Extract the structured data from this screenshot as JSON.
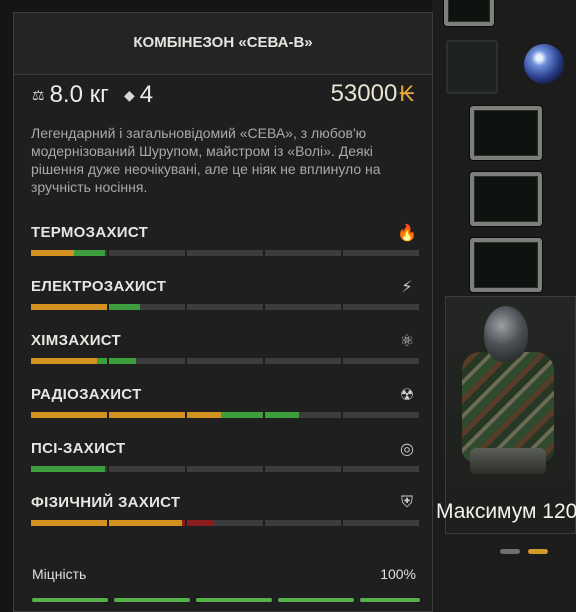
{
  "panel": {
    "title": "КОМБІНЕЗОН «СЕВА-В»",
    "weight": "8.0 кг",
    "slots": "4",
    "price": "53000",
    "currency_symbol": "₭",
    "description": "Легендарний і загальновідомий «СЕВА», з любов'ю модернізований Шурупом, майстром із «Волі». Деякі рішення дуже неочікувані, але це ніяк не вплинуло на зручність носіння."
  },
  "protections": [
    {
      "label": "ТЕРМОЗАХИСТ",
      "icon": "flame-icon",
      "orange": 0.11,
      "green": 0.08,
      "red": 0
    },
    {
      "label": "ЕЛЕКТРОЗАХИСТ",
      "icon": "lightning-shield-icon",
      "orange": 0.2,
      "green": 0.08,
      "red": 0
    },
    {
      "label": "ХІМЗАХИСТ",
      "icon": "chemical-icon",
      "orange": 0.17,
      "green": 0.1,
      "red": 0
    },
    {
      "label": "РАДІОЗАХИСТ",
      "icon": "radiation-icon",
      "orange": 0.49,
      "green": 0.2,
      "red": 0
    },
    {
      "label": "ПСІ-ЗАХИСТ",
      "icon": "psi-icon",
      "orange": 0,
      "green": 0.19,
      "red": 0
    },
    {
      "label": "ФІЗИЧНИЙ ЗАХИСТ",
      "icon": "armor-shield-icon",
      "orange": 0.39,
      "green": 0,
      "red": 0.08
    }
  ],
  "durability": {
    "label": "Міцність",
    "value": "100%"
  },
  "inventory": {
    "item_name": "Максимум 120"
  },
  "colors": {
    "orange": "#d3911f",
    "green": "#3c9e3c",
    "red": "#8a1e1e",
    "track": "#3b3c3b"
  }
}
